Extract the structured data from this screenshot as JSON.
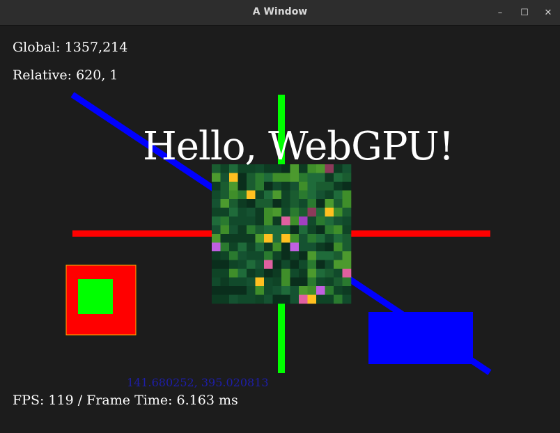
{
  "window": {
    "title": "A Window",
    "buttons": {
      "minimize": "–",
      "maximize": "☐",
      "close": "✕"
    }
  },
  "hud": {
    "global": "Global: 1357,214",
    "relative": "Relative: 620, 1",
    "fps": "FPS: 119 / Frame Time: 6.163 ms",
    "coords": "141.680252, 395.020813"
  },
  "hello_text": "Hello, WebGPU!",
  "colors": {
    "background": "#1c1c1c",
    "titlebar": "#2d2d2d",
    "red": "#ff0000",
    "green": "#00ff00",
    "blue": "#0000ff",
    "coords_text": "#1e1ea8"
  }
}
